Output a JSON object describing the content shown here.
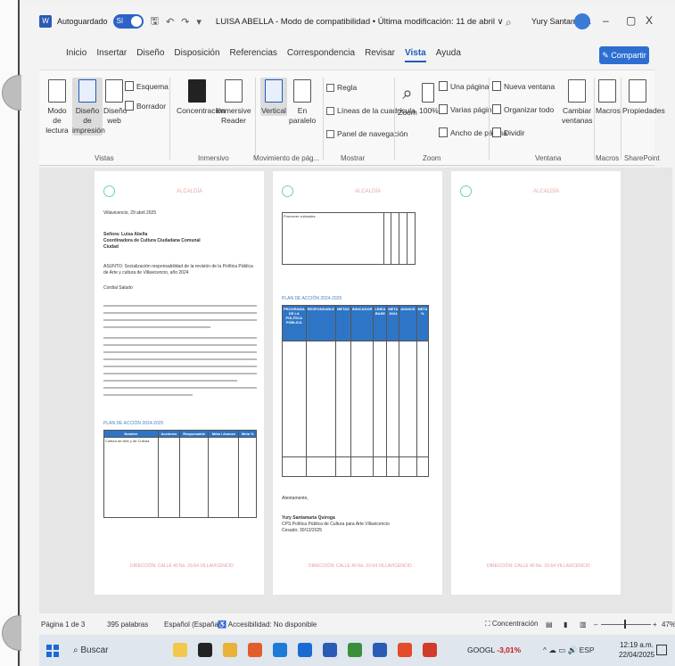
{
  "titlebar": {
    "autosave_label": "Autoguardado",
    "autosave_state": "Sí",
    "doc_title": "LUISA ABELLA - Modo de compatibilidad • Última modificación: 11 de abril ∨",
    "user_name": "Yury Santamaria",
    "minimize": "–",
    "restore": "▢",
    "close": "X"
  },
  "tabs": [
    "Inicio",
    "Insertar",
    "Diseño",
    "Disposición",
    "Referencias",
    "Correspondencia",
    "Revisar",
    "Vista",
    "Ayuda"
  ],
  "active_tab": "Vista",
  "share_label": "Compartir",
  "ribbon": {
    "vistas": {
      "group_label": "Vistas",
      "modo_lectura": "Modo de lectura",
      "diseno_impresion": "Diseño de impresión",
      "diseno_web": "Diseño web",
      "esquema": "Esquema",
      "borrador": "Borrador"
    },
    "inmersivo": {
      "group_label": "Inmersivo",
      "concentracion": "Concentración",
      "immersive_reader": "Immersive Reader"
    },
    "movimiento": {
      "group_label": "Movimiento de pág...",
      "vertical": "Vertical",
      "en_paralelo": "En paralelo"
    },
    "mostrar": {
      "group_label": "Mostrar",
      "regla": "Regla",
      "lineas_cuadricula": "Líneas de la cuadrícula",
      "panel_navegacion": "Panel de navegación"
    },
    "zoom": {
      "group_label": "Zoom",
      "zoom": "Zoom",
      "cien": "100%",
      "una_pagina": "Una página",
      "varias_paginas": "Varias páginas",
      "ancho_pagina": "Ancho de página"
    },
    "ventana": {
      "group_label": "Ventana",
      "nueva_ventana": "Nueva ventana",
      "organizar_todo": "Organizar todo",
      "dividir": "Dividir",
      "cambiar_ventanas": "Cambiar ventanas"
    },
    "macros": {
      "group_label": "Macros",
      "macros": "Macros"
    },
    "sharepoint": {
      "group_label": "SharePoint",
      "propiedades": "Propiedades"
    }
  },
  "document": {
    "page1": {
      "date_line": "Villavicencio, 29 abril 2025",
      "recipient_lines": [
        "Señora: Luisa Abella",
        "Coordinadora de Cultura Ciudadana Comunal",
        "Ciudad"
      ],
      "subject": "ASUNTO: Socialización responsabilidad de la revisión de la Política Pública de Arte y cultura de Villavicencio, año 2024",
      "greeting": "Cordial Saludo",
      "table_title": "PLAN DE ACCIÓN 2024-2025",
      "table_headers": [
        "Nombre",
        "Acciones",
        "Responsable",
        "Meta / Avance",
        "Meta %"
      ],
      "table_row": [
        "Cultura de Arte y de Cultura"
      ]
    },
    "page2": {
      "row_label": "Promover culturales",
      "section_title": "PLAN DE ACCIÓN 2024-2025",
      "table_headers": [
        "PROGRAMA DE LA POLÍTICA PÚBLICA",
        "RESPONSABLE",
        "METAS",
        "INDICADOR",
        "LÍNEA BASE",
        "META 2024",
        "AVANCE",
        "META %"
      ],
      "closing": "Atentamente,",
      "signature_name": "Yury Santamaria Quiroga",
      "signature_role": "CPS Política Pública de Cultura para Arte Villavicencio",
      "signature_extra": "Cesado: 30/12/2025"
    },
    "footer_text": "DIRECCIÓN: CALLE 40 No. 33-64 VILLAVICENCIO",
    "header_text": "ALCALDÍA"
  },
  "status": {
    "page": "Página 1 de 3",
    "words": "395 palabras",
    "language": "Español (España)",
    "accessibility": "Accesibilidad: No disponible",
    "focus": "Concentración",
    "zoom": "47%"
  },
  "taskbar": {
    "search": "Buscar",
    "stock_name": "GOOGL",
    "stock_change": "-3,01%",
    "tray_lang": "ESP",
    "time": "12:19 a.m.",
    "date": "22/04/2025"
  },
  "colors": {
    "accent": "#1d5db8",
    "share": "#2d6fd1",
    "table_header": "#2f75c5"
  }
}
